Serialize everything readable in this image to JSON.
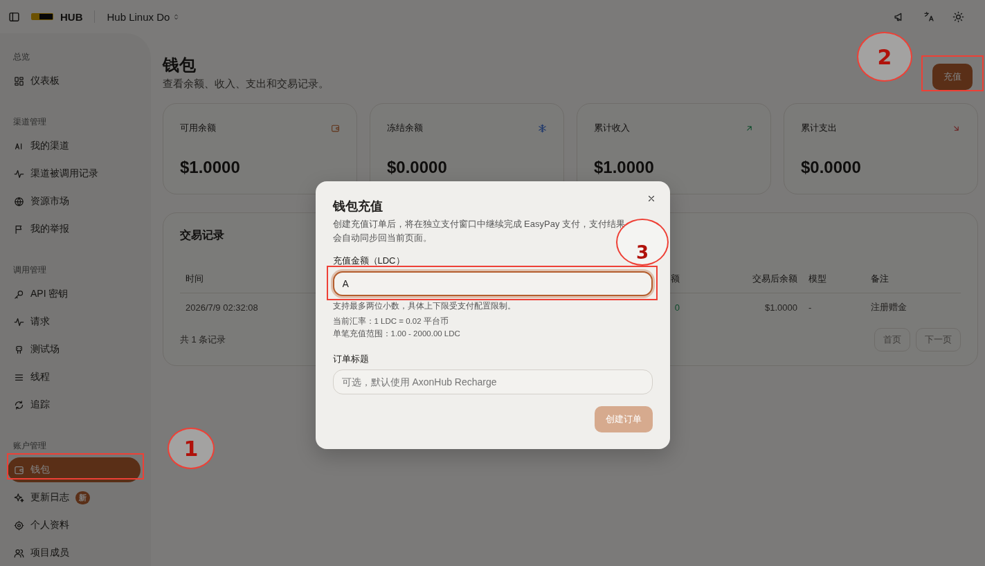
{
  "topbar": {
    "brand": "HUB",
    "project": "Hub Linux Do"
  },
  "sidebar": {
    "sections": [
      {
        "title": "总览",
        "items": [
          {
            "label": "仪表板",
            "selected": false
          }
        ]
      },
      {
        "title": "渠道管理",
        "items": [
          {
            "label": "我的渠道",
            "selected": false
          },
          {
            "label": "渠道被调用记录",
            "selected": false
          },
          {
            "label": "资源市场",
            "selected": false
          },
          {
            "label": "我的举报",
            "selected": false
          }
        ]
      },
      {
        "title": "调用管理",
        "items": [
          {
            "label": "API 密钥",
            "selected": false
          },
          {
            "label": "请求",
            "selected": false
          },
          {
            "label": "测试场",
            "selected": false
          },
          {
            "label": "线程",
            "selected": false
          },
          {
            "label": "追踪",
            "selected": false
          }
        ]
      },
      {
        "title": "账户管理",
        "items": [
          {
            "label": "钱包",
            "selected": true
          },
          {
            "label": "更新日志",
            "selected": false,
            "badge": "新"
          },
          {
            "label": "个人资料",
            "selected": false
          },
          {
            "label": "项目成员",
            "selected": false
          }
        ]
      }
    ]
  },
  "page": {
    "title": "钱包",
    "subtitle": "查看余额、收入、支出和交易记录。",
    "action": "充值"
  },
  "stats": [
    {
      "label": "可用余额",
      "value": "$1.0000"
    },
    {
      "label": "冻结余额",
      "value": "$0.0000"
    },
    {
      "label": "累计收入",
      "value": "$1.0000"
    },
    {
      "label": "累计支出",
      "value": "$0.0000"
    }
  ],
  "transactions": {
    "title": "交易记录",
    "columns": [
      {
        "label": "时间"
      },
      {
        "label": "额"
      },
      {
        "label": "交易后余额"
      },
      {
        "label": "模型"
      },
      {
        "label": "备注"
      }
    ],
    "rows": [
      {
        "cells": [
          "2026/7/9 02:32:08",
          "0",
          "$1.0000",
          "-",
          "注册赠金"
        ]
      }
    ],
    "total": "共 1 条记录",
    "pagination": [
      {
        "label": "首页",
        "disabled": true
      },
      {
        "label": "下一页",
        "disabled": true
      }
    ]
  },
  "dialog": {
    "title": "钱包充值",
    "description": "创建充值订单后，将在独立支付窗口中继续完成 EasyPay 支付，支付结果会自动同步回当前页面。",
    "amount_label": "充值金额（LDC）",
    "amount_value": "A",
    "amount_focused": true,
    "hint": "支持最多两位小数，具体上下限受支付配置限制。",
    "rate": "当前汇率：1 LDC = 0.02 平台币",
    "range": "单笔充值范围：1.00 - 2000.00 LDC",
    "order_title_label": "订单标题",
    "order_title_placeholder": "可选，默认使用 AxonHub Recharge",
    "submit": {
      "label": "创建订单",
      "disabled": true
    }
  },
  "annotations": [
    {
      "kind": "circle",
      "label": "1"
    },
    {
      "kind": "box"
    },
    {
      "kind": "circle",
      "label": "2"
    },
    {
      "kind": "box"
    },
    {
      "kind": "circle",
      "label": "3"
    },
    {
      "kind": "box"
    }
  ]
}
